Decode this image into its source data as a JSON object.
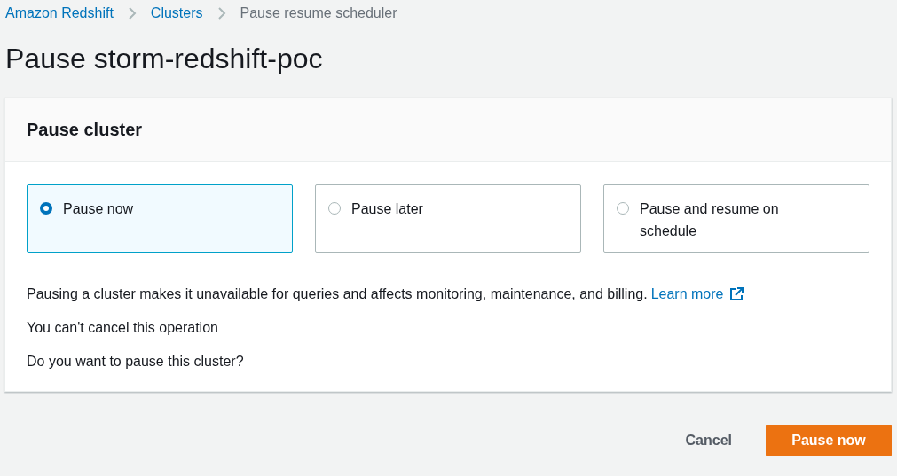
{
  "breadcrumbs": [
    {
      "label": "Amazon Redshift",
      "current": false
    },
    {
      "label": "Clusters",
      "current": false
    },
    {
      "label": "Pause resume scheduler",
      "current": true
    }
  ],
  "page_title": "Pause storm-redshift-poc",
  "panel": {
    "title": "Pause cluster",
    "options": [
      {
        "label": "Pause now",
        "selected": true
      },
      {
        "label": "Pause later",
        "selected": false
      },
      {
        "label": "Pause and resume on schedule",
        "selected": false
      }
    ],
    "description": {
      "text": "Pausing a cluster makes it unavailable for queries and affects monitoring, maintenance, and billing.",
      "link": "Learn more"
    },
    "notes": [
      "You can't cancel this operation",
      "Do you want to pause this cluster?"
    ]
  },
  "buttons": [
    {
      "label": "Cancel",
      "kind": "link"
    },
    {
      "label": "Pause now",
      "kind": "primary"
    }
  ]
}
